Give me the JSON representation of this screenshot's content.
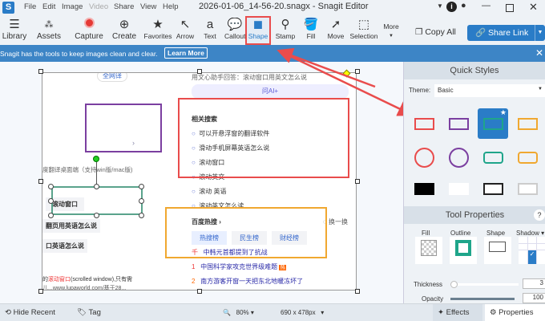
{
  "app": {
    "title": "2026-01-06_14-56-20.snagx - Snagit Editor",
    "logo": "S"
  },
  "menu": [
    "File",
    "Edit",
    "Image",
    "Video",
    "Share",
    "View",
    "Help"
  ],
  "toolbar": {
    "left": [
      {
        "label": "Library",
        "icon": "menu-icon"
      },
      {
        "label": "Assets",
        "icon": "assets-icon"
      },
      {
        "label": "Capture",
        "icon": "record-icon"
      },
      {
        "label": "Create",
        "icon": "plus-circle-icon"
      }
    ],
    "tools": [
      {
        "label": "Favorites",
        "icon": "star-icon"
      },
      {
        "label": "Arrow",
        "icon": "arrow-icon"
      },
      {
        "label": "Text",
        "icon": "text-icon"
      },
      {
        "label": "Callout",
        "icon": "callout-icon"
      },
      {
        "label": "Shape",
        "icon": "shape-icon",
        "active": true
      },
      {
        "label": "Stamp",
        "icon": "stamp-icon"
      },
      {
        "label": "Fill",
        "icon": "fill-icon"
      },
      {
        "label": "Move",
        "icon": "move-icon"
      },
      {
        "label": "Selection",
        "icon": "selection-icon"
      }
    ],
    "more": "More",
    "copy_all": "Copy All",
    "share_link": "Share Link"
  },
  "banner": {
    "text": "Snagit has the tools to keep images clean and clear.",
    "button": "Learn More"
  },
  "canvas_content": {
    "top_left_tag": "全网译",
    "top_line": "用文心助手回答：滚动窗口用英文怎么说",
    "ask_ai": "问AI+",
    "left_caption": "度翻译桌面端（支持win版/mac版)",
    "left_chip1": "滚动窗口",
    "left_chip2": "翻页用英语怎么说",
    "left_chip3": "口英语怎么说",
    "left_snippet1_pre": "的",
    "left_snippet1_red": "滚动窗口",
    "left_snippet1_post": "(scrolled window),只有需",
    "left_snippet2": "儿...www.lupaworld.com/基于28...",
    "related_title": "相关搜索",
    "related": [
      "可以开悬浮窗的翻译软件",
      "滑动手机屏幕英语怎么说",
      "滚动窗口",
      "滚动英文",
      "滚动 英语",
      "滚动英文怎么读"
    ],
    "hot_title": "百度热搜",
    "refresh": "换一换",
    "hot_tabs": [
      "热搜榜",
      "民生榜",
      "财经榜"
    ],
    "hot_items": [
      {
        "rank": "千",
        "text": "中韩元首都提到了抗战"
      },
      {
        "rank": "1",
        "text": "中国科学家攻克世界级难题",
        "badge": "热"
      },
      {
        "rank": "2",
        "text": "南方游客开窗一天把东北地暖冻坏了"
      }
    ]
  },
  "panel": {
    "quick_styles": "Quick Styles",
    "theme_label": "Theme:",
    "theme_value": "Basic",
    "styles_colors": [
      "#e94c4c",
      "#7b3fa0",
      "#1fa58a",
      "#f0a830"
    ],
    "tool_properties": "Tool Properties",
    "help": "?",
    "fill": "Fill",
    "outline": "Outline",
    "shape": "Shape",
    "shadow": "Shadow",
    "outline_color": "#1fa58a",
    "thickness_label": "Thickness",
    "thickness_value": "3",
    "opacity_label": "Opacity",
    "opacity_value": "100"
  },
  "bottom": {
    "hide_recent": "Hide Recent",
    "tag": "Tag",
    "zoom": "80%",
    "size": "690 x 478px",
    "effects": "Effects",
    "properties": "Properties"
  },
  "colors": {
    "accent": "#3d85c6",
    "highlight_red": "#e94c4c"
  }
}
